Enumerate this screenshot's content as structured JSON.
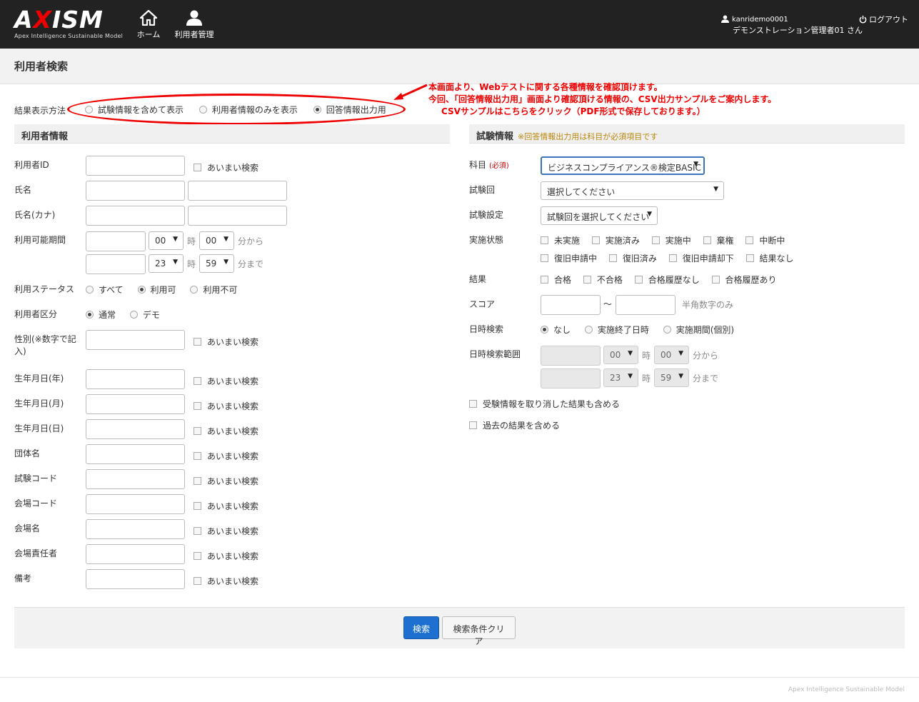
{
  "header": {
    "logo_text": "AXISM",
    "logo_tagline": "Apex Intelligence Sustainable Model",
    "nav_home": "ホーム",
    "nav_users": "利用者管理",
    "username": "kanridemo0001",
    "fullname": "デモンストレーション管理者01 さん",
    "logout": "ログアウト"
  },
  "page_title": "利用者検索",
  "display_mode": {
    "label": "結果表示方法",
    "options": [
      "試験情報を含めて表示",
      "利用者情報のみを表示",
      "回答情報出力用"
    ],
    "selected": "回答情報出力用"
  },
  "annotation": {
    "line1": "本画面より、Webテストに関する各種情報を確認頂けます。",
    "line2": "今回、「回答情報出力用」画面より確認頂ける情報の、CSV出力サンプルをご案内します。",
    "line3": "CSVサンプルはこちらをクリック（PDF形式で保存しております。）"
  },
  "user_info": {
    "heading": "利用者情報",
    "fuzzy": "あいまい検索",
    "user_id": "利用者ID",
    "name": "氏名",
    "name_kana": "氏名(カナ)",
    "period": "利用可能期間",
    "period_from_h": "00",
    "period_from_m": "00",
    "period_to_h": "23",
    "period_to_m": "59",
    "hour": "時",
    "from": "分から",
    "to": "分まで",
    "status": "利用ステータス",
    "status_opts": [
      "すべて",
      "利用可",
      "利用不可"
    ],
    "category": "利用者区分",
    "category_opts": [
      "通常",
      "デモ"
    ],
    "gender_l1": "性別(※数字で記",
    "gender_l2": "入)",
    "birth_y": "生年月日(年)",
    "birth_m": "生年月日(月)",
    "birth_d": "生年月日(日)",
    "org": "団体名",
    "exam_code": "試験コード",
    "venue_code": "会場コード",
    "venue_name": "会場名",
    "venue_manager": "会場責任者",
    "memo": "備考"
  },
  "exam_info": {
    "heading": "試験情報",
    "note": "※回答情報出力用は科目が必須項目です",
    "subject": "科目",
    "required": "(必須)",
    "subject_value": "ビジネスコンプライアンス®検定BASIC",
    "round": "試験回",
    "round_value": "選択してください",
    "setting": "試験設定",
    "setting_value": "試験回を選択してください",
    "state": "実施状態",
    "state_opts_row1": [
      "未実施",
      "実施済み",
      "実施中",
      "棄権",
      "中断中"
    ],
    "state_opts_row2": [
      "復旧申請中",
      "復旧済み",
      "復旧申請却下",
      "結果なし"
    ],
    "result": "結果",
    "result_opts": [
      "合格",
      "不合格",
      "合格履歴なし",
      "合格履歴あり"
    ],
    "score": "スコア",
    "tilde": "〜",
    "score_note": "半角数字のみ",
    "date_search": "日時検索",
    "date_opts": [
      "なし",
      "実施終了日時",
      "実施期間(個別)"
    ],
    "date_range": "日時検索範囲",
    "range_from_h": "00",
    "range_from_m": "00",
    "range_to_h": "23",
    "range_to_m": "59",
    "include_cancelled": "受験情報を取り消した結果も含める",
    "include_past": "過去の結果を含める"
  },
  "buttons": {
    "search": "検索",
    "clear": "検索条件クリア"
  },
  "footer": "Apex Intelligence Sustainable Model"
}
